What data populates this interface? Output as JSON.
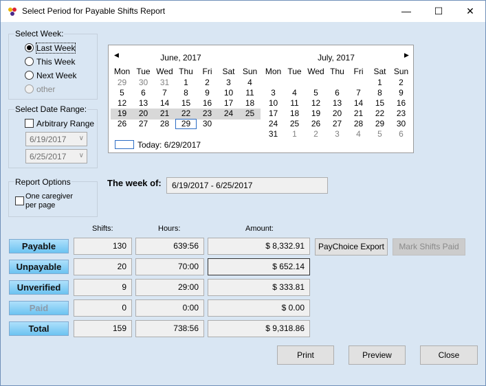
{
  "window": {
    "title": "Select Period for Payable Shifts Report",
    "controls": {
      "minimize": "—",
      "maximize": "☐",
      "close": "✕"
    }
  },
  "select_week": {
    "legend": "Select Week:",
    "options": [
      "Last Week",
      "This Week",
      "Next Week",
      "other"
    ],
    "selected": "Last Week"
  },
  "date_range": {
    "legend": "Select Date Range:",
    "arbitrary_label": "Arbitrary Range",
    "start": "6/19/2017",
    "end": "6/25/2017"
  },
  "report_options": {
    "legend": "Report Options",
    "one_caregiver_line1": "One caregiver",
    "one_caregiver_line2": "per page"
  },
  "calendar": {
    "day_headers": [
      "Mon",
      "Tue",
      "Wed",
      "Thu",
      "Fri",
      "Sat",
      "Sun"
    ],
    "months": [
      {
        "title": "June, 2017",
        "weeks": [
          [
            "29",
            "30",
            "31",
            "1",
            "2",
            "3",
            "4"
          ],
          [
            "5",
            "6",
            "7",
            "8",
            "9",
            "10",
            "11"
          ],
          [
            "12",
            "13",
            "14",
            "15",
            "16",
            "17",
            "18"
          ],
          [
            "19",
            "20",
            "21",
            "22",
            "23",
            "24",
            "25"
          ],
          [
            "26",
            "27",
            "28",
            "29",
            "30",
            "",
            ""
          ]
        ]
      },
      {
        "title": "July, 2017",
        "weeks": [
          [
            "",
            "",
            "",
            "",
            "",
            "1",
            "2"
          ],
          [
            "3",
            "4",
            "5",
            "6",
            "7",
            "8",
            "9"
          ],
          [
            "10",
            "11",
            "12",
            "13",
            "14",
            "15",
            "16"
          ],
          [
            "17",
            "18",
            "19",
            "20",
            "21",
            "22",
            "23"
          ],
          [
            "24",
            "25",
            "26",
            "27",
            "28",
            "29",
            "30"
          ],
          [
            "31",
            "1",
            "2",
            "3",
            "4",
            "5",
            "6"
          ]
        ]
      }
    ],
    "today_label": "Today: 6/29/2017"
  },
  "week_of": {
    "label": "The week of:",
    "value": "6/19/2017 - 6/25/2017"
  },
  "summary": {
    "headers": {
      "shifts": "Shifts:",
      "hours": "Hours:",
      "amount": "Amount:"
    },
    "rows": [
      {
        "label": "Payable",
        "shifts": "130",
        "hours": "639:56",
        "amount": "$ 8,332.91"
      },
      {
        "label": "Unpayable",
        "shifts": "20",
        "hours": "70:00",
        "amount": "$ 652.14"
      },
      {
        "label": "Unverified",
        "shifts": "9",
        "hours": "29:00",
        "amount": "$ 333.81"
      },
      {
        "label": "Paid",
        "shifts": "0",
        "hours": "0:00",
        "amount": "$ 0.00"
      },
      {
        "label": "Total",
        "shifts": "159",
        "hours": "738:56",
        "amount": "$ 9,318.86"
      }
    ]
  },
  "buttons": {
    "paychoice_export": "PayChoice Export",
    "mark_shifts_paid": "Mark Shifts Paid",
    "print": "Print",
    "preview": "Preview",
    "close": "Close"
  }
}
